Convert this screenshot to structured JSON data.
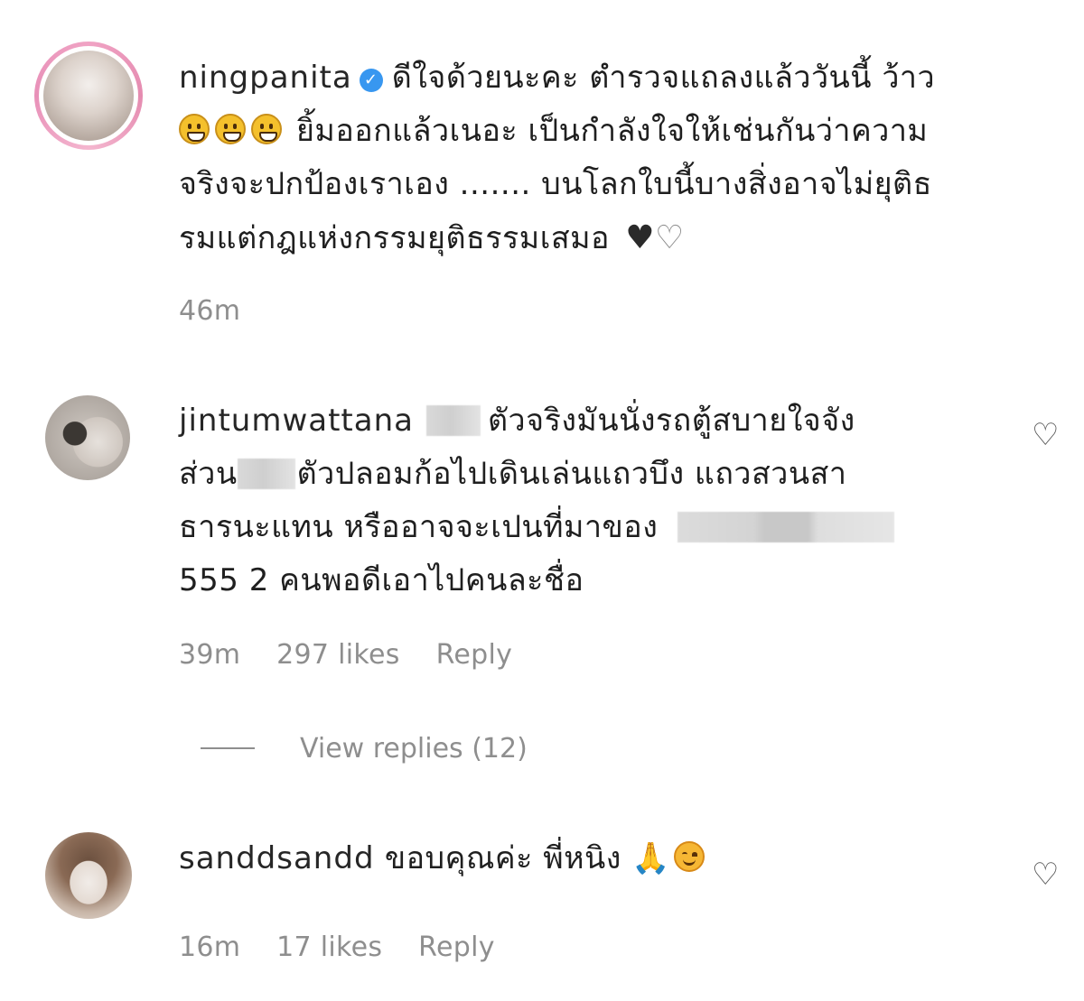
{
  "comments": [
    {
      "username": "ningpanita",
      "verified_mark": "✓",
      "line1": "ดีใจด้วยนะคะ ตำรวจแถลงแล้ววันนี้ ว้าว",
      "line2": "ยิ้มออกแล้วเนอะ เป็นกำลังใจให้เช่นกันว่าความ",
      "line3": "จริงจะปกป้องเราเอง ....... บนโลกใบนี้บางสิ่งอาจไม่ยุติธ",
      "line4": "รมแต่กฎแห่งกรรมยุติธรรมเสมอ",
      "emojis": [
        "grinning-face",
        "grinning-face",
        "grinning-face"
      ],
      "end_emojis": [
        "black-heart",
        "white-heart"
      ],
      "time": "46m"
    },
    {
      "username": "jintumwattana",
      "line1_after_blur": "ตัวจริงมันนั่งรถตู้สบายใจจัง",
      "line2_before_blur": "ส่วน",
      "line2_after_blur": "ตัวปลอมก้อไปเดินเล่นแถวบึง แถวสวนสา",
      "line3": "ธารนะแทน หรืออาจจะเปนที่มาของ",
      "line4": "555 2 คนพอดีเอาไปคนละชื่อ",
      "time": "39m",
      "likes": "297 likes",
      "reply": "Reply",
      "view_replies": "View replies (12)"
    },
    {
      "username": "sanddsandd",
      "text": "ขอบคุณค่ะ พี่หนิง",
      "end_emojis": [
        "folded-hands",
        "smiling-face"
      ],
      "time": "16m",
      "likes": "17 likes",
      "reply": "Reply"
    }
  ],
  "icons": {
    "heart_outline": "♡",
    "heart_black": "♥",
    "heart_white": "♡",
    "pray": "🙏"
  }
}
